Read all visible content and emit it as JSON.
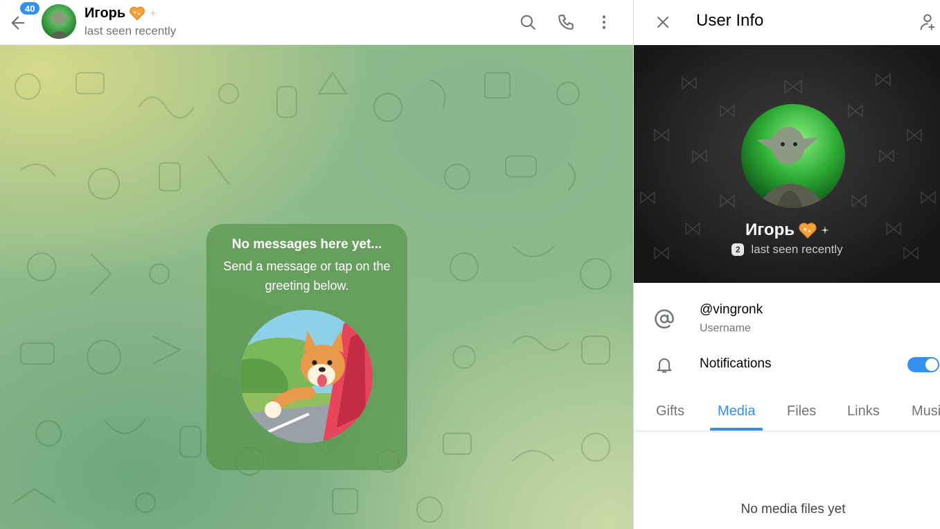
{
  "chat": {
    "unread_badge": "40",
    "title": "Игорь",
    "status": "last seen recently",
    "header_icons": [
      "search-icon",
      "phone-icon",
      "more-vertical-icon"
    ],
    "empty_state": {
      "title": "No messages here yet...",
      "text": "Send a message or tap on the greeting below."
    }
  },
  "info": {
    "title": "User Info",
    "profile": {
      "name": "Игорь",
      "gift_count": "2",
      "status": "last seen recently"
    },
    "username": {
      "value": "@vingronk",
      "label": "Username"
    },
    "notifications": {
      "label": "Notifications",
      "enabled": true
    },
    "tabs": [
      {
        "label": "Gifts",
        "active": false
      },
      {
        "label": "Media",
        "active": true
      },
      {
        "label": "Files",
        "active": false
      },
      {
        "label": "Links",
        "active": false
      },
      {
        "label": "Music",
        "active": false
      }
    ],
    "empty_media": "No media files yet"
  },
  "colors": {
    "accent": "#3390ec",
    "secondary_text": "#707579",
    "card_green": "#58944b"
  }
}
